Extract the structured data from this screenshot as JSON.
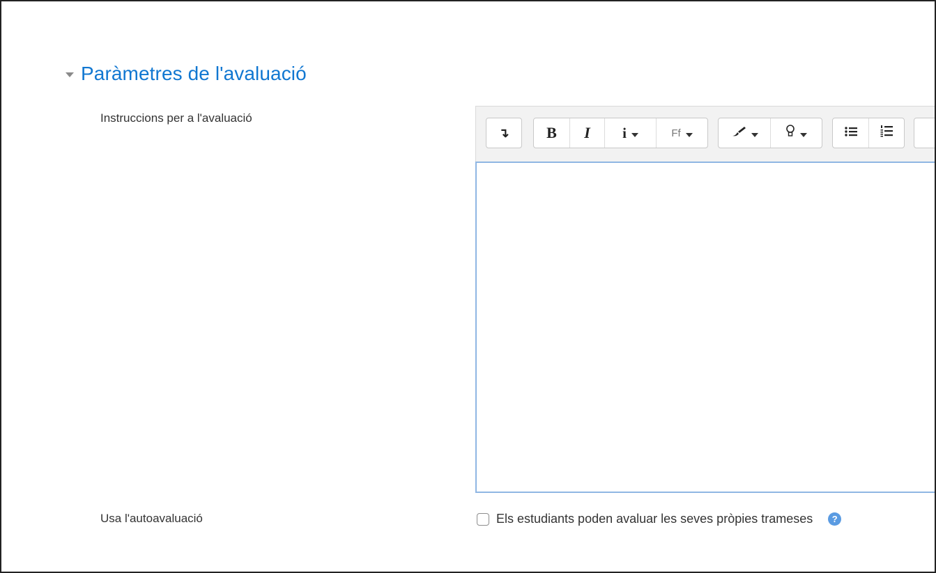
{
  "section": {
    "title": "Paràmetres de l'avaluació",
    "collapse_icon": "caret-down-icon"
  },
  "fields": {
    "instructions_label": "Instruccions per a l'avaluació",
    "selfassessment_label": "Usa l'autoavaluació",
    "selfassessment_checkbox_label": "Els estudiants poden avaluar les seves pròpies trameses",
    "selfassessment_checked": false
  },
  "toolbar": {
    "toggle_icon": "↴",
    "bold_label": "B",
    "italic_label": "I",
    "style_label": "i",
    "font_label": "Ff",
    "color_icon": "brush-icon",
    "highlight_icon": "bulb-icon",
    "unordered_list_icon": "unordered-list-icon",
    "ordered_list_icon": "ordered-list-icon"
  },
  "help": {
    "icon_text": "?"
  },
  "colors": {
    "accent": "#1177d1",
    "editor_border": "#8fb6e3",
    "help": "#5a9be2"
  }
}
